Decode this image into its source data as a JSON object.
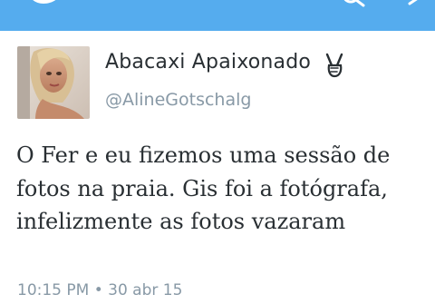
{
  "tweet": {
    "display_name": "Abacaxi Apaixonado",
    "handle": "@AlineGotschalg",
    "text": "O Fer e eu fizemos uma sessão de fotos na praia. Gis foi a fotógrafa, infelizmente as fotos vazaram",
    "timestamp": "10:15 PM • 30 abr 15"
  },
  "icons": {
    "bird": "twitter-bird-icon",
    "search": "search-icon",
    "compose": "compose-icon",
    "emoji": "victory-hand-emoji"
  },
  "colors": {
    "header": "#55acee",
    "text": "#292f33",
    "muted": "#8899a6"
  }
}
